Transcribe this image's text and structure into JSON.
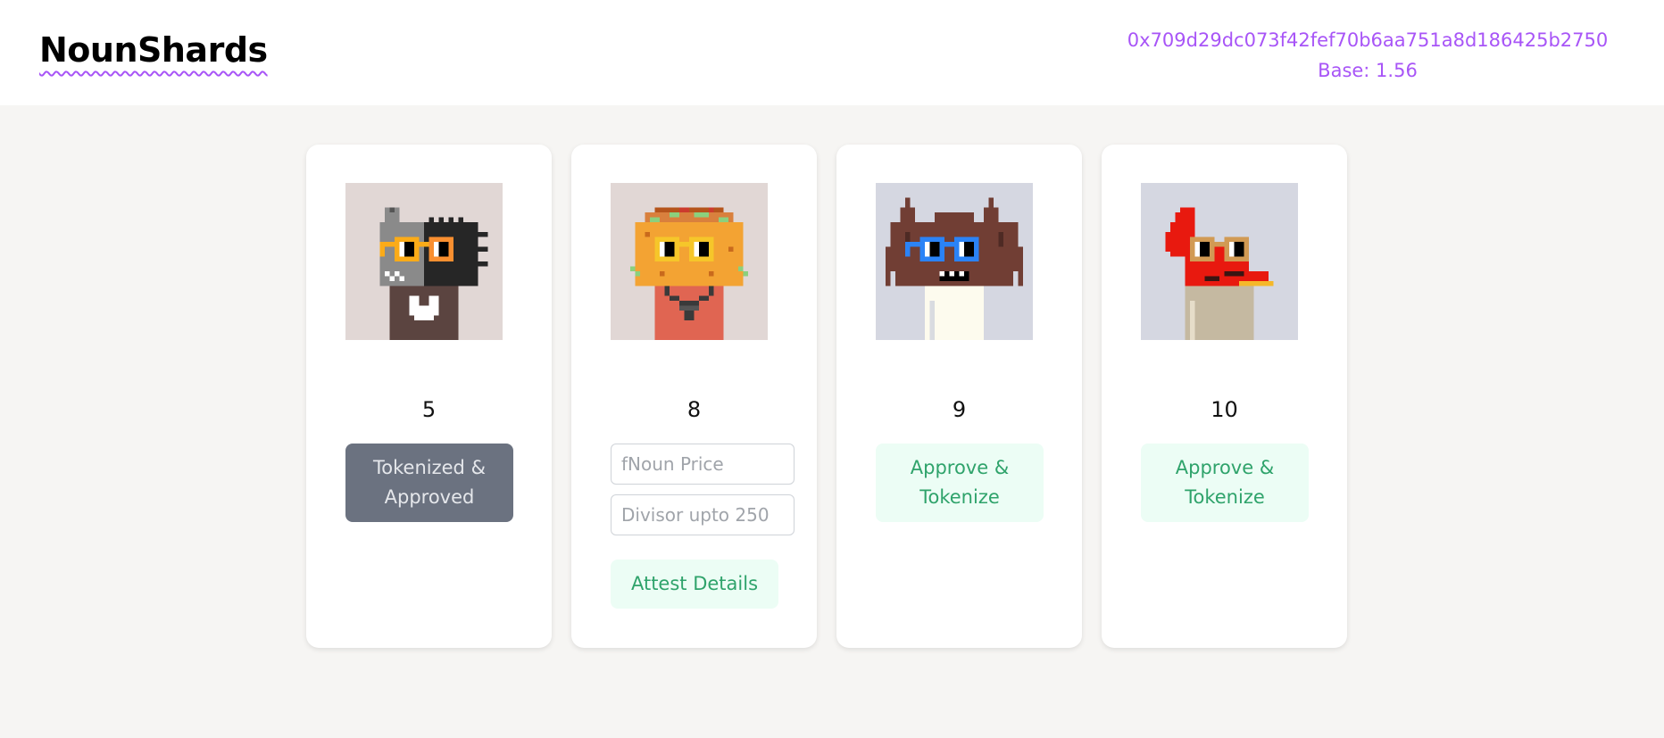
{
  "app": {
    "title": "NounShards"
  },
  "account": {
    "address": "0x709d29dc073f42fef70b6aa751a8d186425b2750",
    "base_label": "Base: 1.56"
  },
  "cards": [
    {
      "id": "5",
      "bg": "#e1d7d5",
      "action_label": "Tokenized & Approved"
    },
    {
      "id": "8",
      "bg": "#e1d7d5",
      "inputs": [
        {
          "placeholder": "fNoun Price"
        },
        {
          "placeholder": "Divisor upto 250"
        }
      ],
      "action_label": "Attest Details"
    },
    {
      "id": "9",
      "bg": "#d5d7e1",
      "action_label": "Approve & Tokenize"
    },
    {
      "id": "10",
      "bg": "#d5d7e1",
      "action_label": "Approve & Tokenize"
    }
  ],
  "colors": {
    "accent": "#a855f7",
    "success": "#2fa36b",
    "success_bg": "#ecfdf5",
    "disabled": "#6b7280"
  }
}
